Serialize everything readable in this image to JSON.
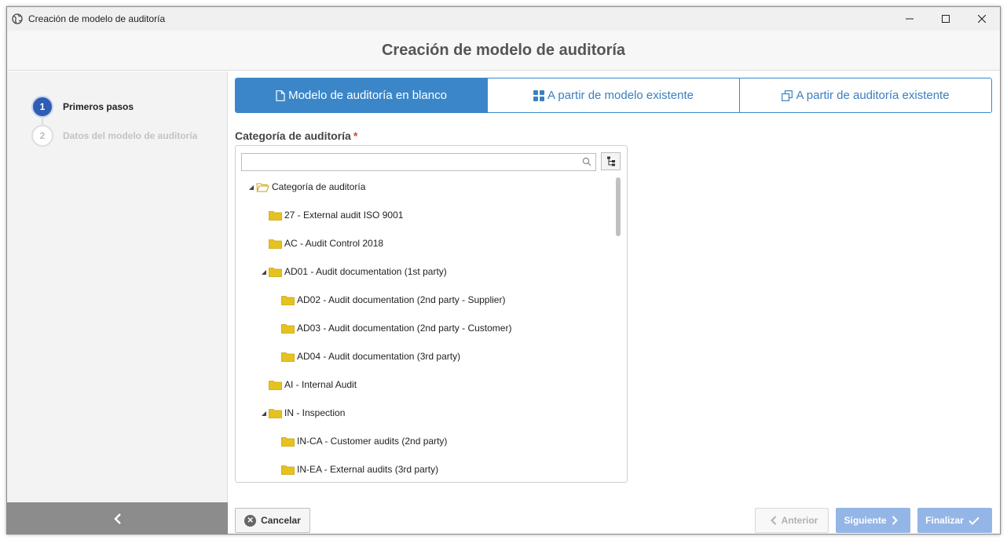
{
  "window": {
    "title": "Creación de modelo de auditoría",
    "minimize_icon": "minimize-icon",
    "maximize_icon": "maximize-icon",
    "close_icon": "close-icon"
  },
  "header": {
    "title": "Creación de modelo de auditoría"
  },
  "steps": [
    {
      "number": "1",
      "label": "Primeros pasos",
      "state": "active"
    },
    {
      "number": "2",
      "label": "Datos del modelo de auditoría",
      "state": "inactive"
    }
  ],
  "tabs": [
    {
      "label": "Modelo de auditoría en blanco",
      "icon": "document-icon",
      "active": true
    },
    {
      "label": "A partir de modelo existente",
      "icon": "grid-icon",
      "active": false
    },
    {
      "label": "A partir de auditoría existente",
      "icon": "copy-icon",
      "active": false
    }
  ],
  "field": {
    "label": "Categoría de auditoría",
    "required_marker": "*"
  },
  "search": {
    "value": "",
    "placeholder": ""
  },
  "tree": [
    {
      "label": "Categoría de auditoría",
      "depth": 0,
      "expanded": true,
      "folder": "open"
    },
    {
      "label": "27 - External audit ISO 9001",
      "depth": 1,
      "expanded": null,
      "folder": "closed"
    },
    {
      "label": "AC - Audit Control 2018",
      "depth": 1,
      "expanded": null,
      "folder": "closed"
    },
    {
      "label": "AD01 - Audit documentation (1st party)",
      "depth": 1,
      "expanded": true,
      "folder": "closed"
    },
    {
      "label": "AD02 - Audit documentation (2nd party - Supplier)",
      "depth": 2,
      "expanded": null,
      "folder": "closed"
    },
    {
      "label": "AD03 - Audit documentation (2nd party - Customer)",
      "depth": 2,
      "expanded": null,
      "folder": "closed"
    },
    {
      "label": "AD04 - Audit documentation (3rd party)",
      "depth": 2,
      "expanded": null,
      "folder": "closed"
    },
    {
      "label": "AI - Internal Audit",
      "depth": 1,
      "expanded": null,
      "folder": "closed"
    },
    {
      "label": "IN - Inspection",
      "depth": 1,
      "expanded": true,
      "folder": "closed"
    },
    {
      "label": "IN-CA - Customer audits (2nd party)",
      "depth": 2,
      "expanded": null,
      "folder": "closed"
    },
    {
      "label": "IN-EA - External audits (3rd party)",
      "depth": 2,
      "expanded": null,
      "folder": "closed"
    }
  ],
  "buttons": {
    "cancel": "Cancelar",
    "previous": "Anterior",
    "next": "Siguiente",
    "finish": "Finalizar"
  },
  "colors": {
    "accent": "#3b86c9",
    "step_active": "#2f5db4",
    "folder": "#e6c21e",
    "primary_disabled": "#93b6e6"
  }
}
